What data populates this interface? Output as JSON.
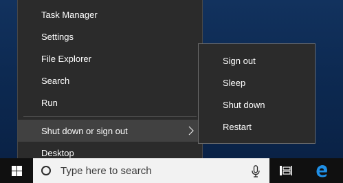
{
  "context_menu": {
    "items": [
      {
        "label": "Task Manager"
      },
      {
        "label": "Settings"
      },
      {
        "label": "File Explorer"
      },
      {
        "label": "Search"
      },
      {
        "label": "Run"
      }
    ],
    "shutdown_item": {
      "label": "Shut down or sign out",
      "highlighted": true,
      "icon": "chevron-right-icon"
    },
    "desktop_item": {
      "label": "Desktop"
    }
  },
  "submenu": {
    "items": [
      {
        "label": "Sign out"
      },
      {
        "label": "Sleep"
      },
      {
        "label": "Shut down"
      },
      {
        "label": "Restart"
      }
    ]
  },
  "taskbar": {
    "start_icon": "windows-logo-icon",
    "search_placeholder": "Type here to search",
    "search_icon": "cortana-circle-icon",
    "mic_icon": "microphone-icon",
    "task_view_icon": "task-view-icon",
    "edge_icon": "edge-browser-icon"
  },
  "colors": {
    "menu_bg": "#2b2b2b",
    "menu_highlight": "#414141",
    "taskbar_bg": "#101010",
    "desktop_bg": "#12325e",
    "edge_blue": "#1f8fe6"
  }
}
